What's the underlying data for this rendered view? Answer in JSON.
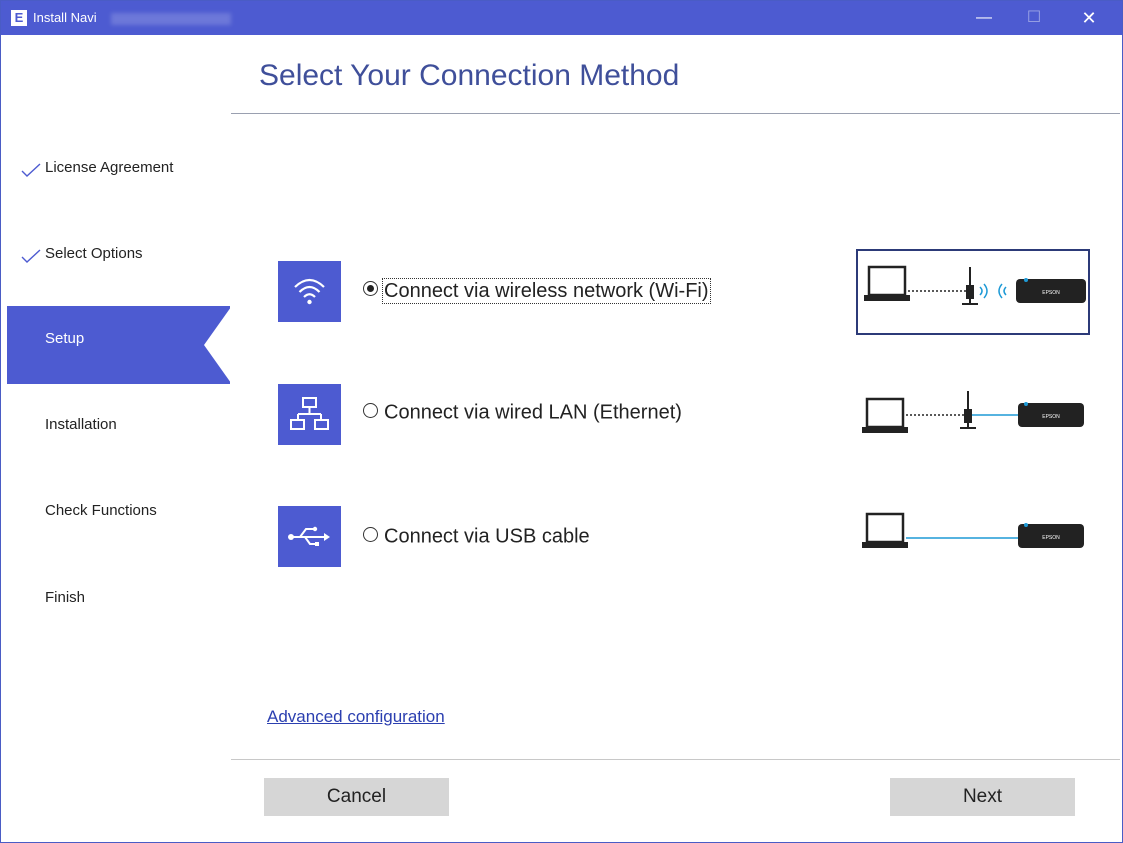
{
  "window": {
    "app_icon_letter": "E",
    "title": "Install Navi",
    "minimize_glyph": "—",
    "maximize_glyph": "☐",
    "close_glyph": "✕"
  },
  "header": {
    "title": "Select Your Connection Method"
  },
  "sidebar": {
    "steps": [
      {
        "label": "License Agreement",
        "state": "done"
      },
      {
        "label": "Select Options",
        "state": "done"
      },
      {
        "label": "Setup",
        "state": "active"
      },
      {
        "label": "Installation",
        "state": "pending"
      },
      {
        "label": "Check Functions",
        "state": "pending"
      },
      {
        "label": "Finish",
        "state": "pending"
      }
    ]
  },
  "options": [
    {
      "label": "Connect via wireless network (Wi-Fi)",
      "icon": "wifi-icon",
      "selected": true
    },
    {
      "label": "Connect via wired LAN (Ethernet)",
      "icon": "network-icon",
      "selected": false
    },
    {
      "label": "Connect via USB cable",
      "icon": "usb-icon",
      "selected": false
    }
  ],
  "illustration": {
    "printer_brand": "EPSON"
  },
  "footer": {
    "advanced_link": "Advanced configuration",
    "cancel_label": "Cancel",
    "next_label": "Next"
  },
  "colors": {
    "accent": "#4d5bd1",
    "title_text": "#3f4f9a",
    "link": "#2b3fb0",
    "check": "#4d5bd1",
    "button": "#d6d6d6"
  }
}
